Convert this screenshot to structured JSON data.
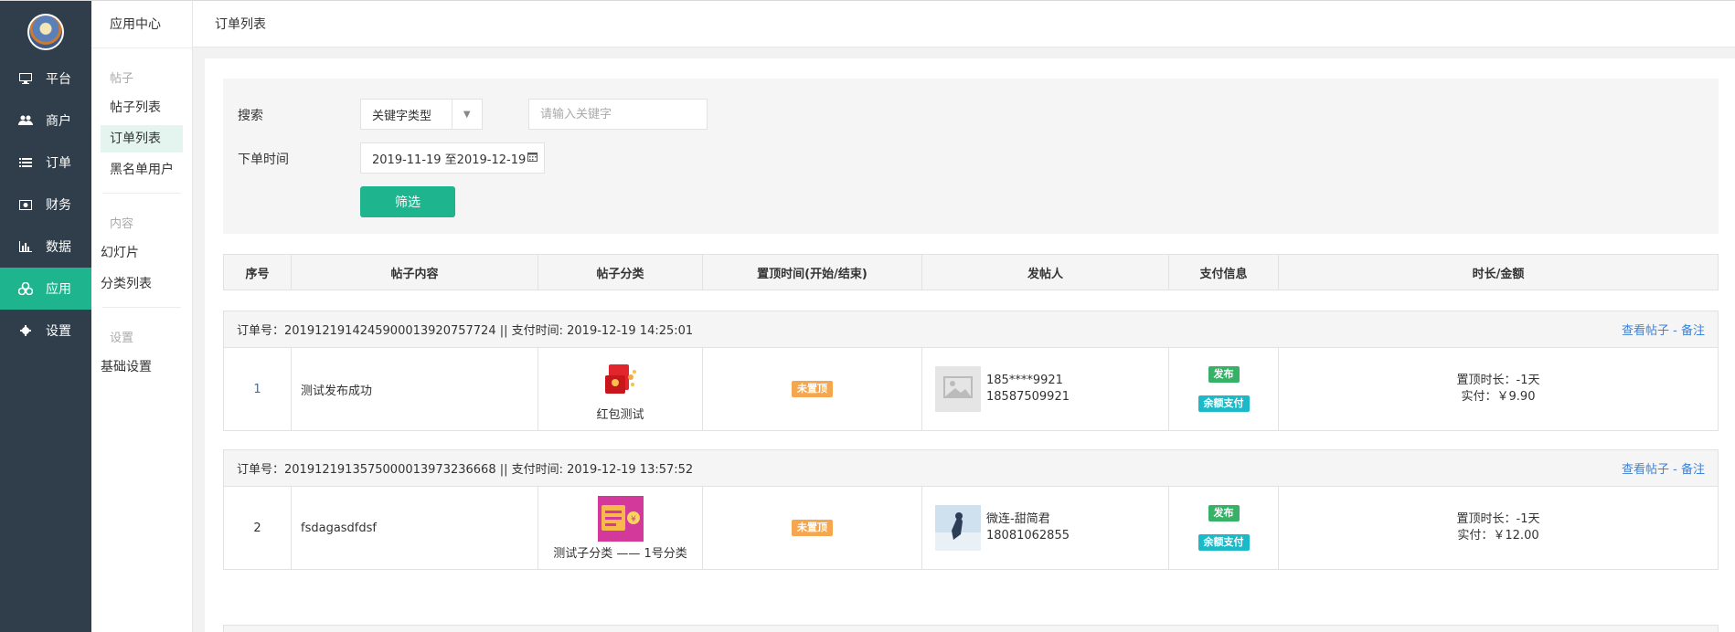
{
  "sidebar": {
    "items": [
      {
        "label": "平台",
        "icon": "monitor-icon"
      },
      {
        "label": "商户",
        "icon": "users-icon"
      },
      {
        "label": "订单",
        "icon": "list-icon"
      },
      {
        "label": "财务",
        "icon": "money-icon"
      },
      {
        "label": "数据",
        "icon": "bar-chart-icon"
      },
      {
        "label": "应用",
        "icon": "apps-icon",
        "active": true
      },
      {
        "label": "设置",
        "icon": "gear-icon"
      }
    ]
  },
  "subnav": {
    "title": "应用中心",
    "groups": [
      {
        "label": "帖子",
        "items": [
          "帖子列表",
          "订单列表",
          "黑名单用户"
        ]
      },
      {
        "label": "内容",
        "items": [
          "幻灯片",
          "分类列表"
        ]
      },
      {
        "label": "设置",
        "items": [
          "基础设置"
        ]
      }
    ]
  },
  "header": {
    "title": "订单列表"
  },
  "filter": {
    "search_label": "搜索",
    "keyword_type": "关键字类型",
    "keyword_placeholder": "请输入关键字",
    "time_label": "下单时间",
    "date_range": "2019-11-19 至2019-12-19",
    "filter_button": "筛选"
  },
  "table": {
    "columns": [
      "序号",
      "帖子内容",
      "帖子分类",
      "置顶时间(开始/结束)",
      "发帖人",
      "支付信息",
      "时长/金额"
    ]
  },
  "orders": [
    {
      "header": "订单号：20191219142459000139207577 24 || 支付时间: 2019-12-19 14:25:01",
      "header_text": "订单号：2019121914245900013920757724 || 支付时间: 2019-12-19 14:25:01",
      "links": "查看帖子 - 备注",
      "index": "1",
      "content": "测试发布成功",
      "category": "红包测试",
      "top_status": "未置顶",
      "poster_phone_masked": "185****9921",
      "poster_phone": "18587509921",
      "pay_tag1": "发布",
      "pay_tag2": "余额支付",
      "duration": "置顶时长：-1天",
      "amount": "实付：￥9.90"
    },
    {
      "header_text": "订单号：2019121913575000013973236668 || 支付时间: 2019-12-19 13:57:52",
      "links": "查看帖子 - 备注",
      "index": "2",
      "content": "fsdagasdfdsf",
      "category": "测试子分类 —— 1号分类",
      "top_status": "未置顶",
      "poster_name": "微连-甜简君",
      "poster_phone": "18081062855",
      "pay_tag1": "发布",
      "pay_tag2": "余额支付",
      "duration": "置顶时长：-1天",
      "amount": "实付：￥12.00"
    }
  ],
  "colors": {
    "sidebar_bg": "#2f3e4a",
    "accent": "#1eb48e",
    "link": "#3b82d6",
    "tag_orange": "#f5a64f",
    "tag_green": "#36b266",
    "tag_teal": "#1cb9c8"
  }
}
